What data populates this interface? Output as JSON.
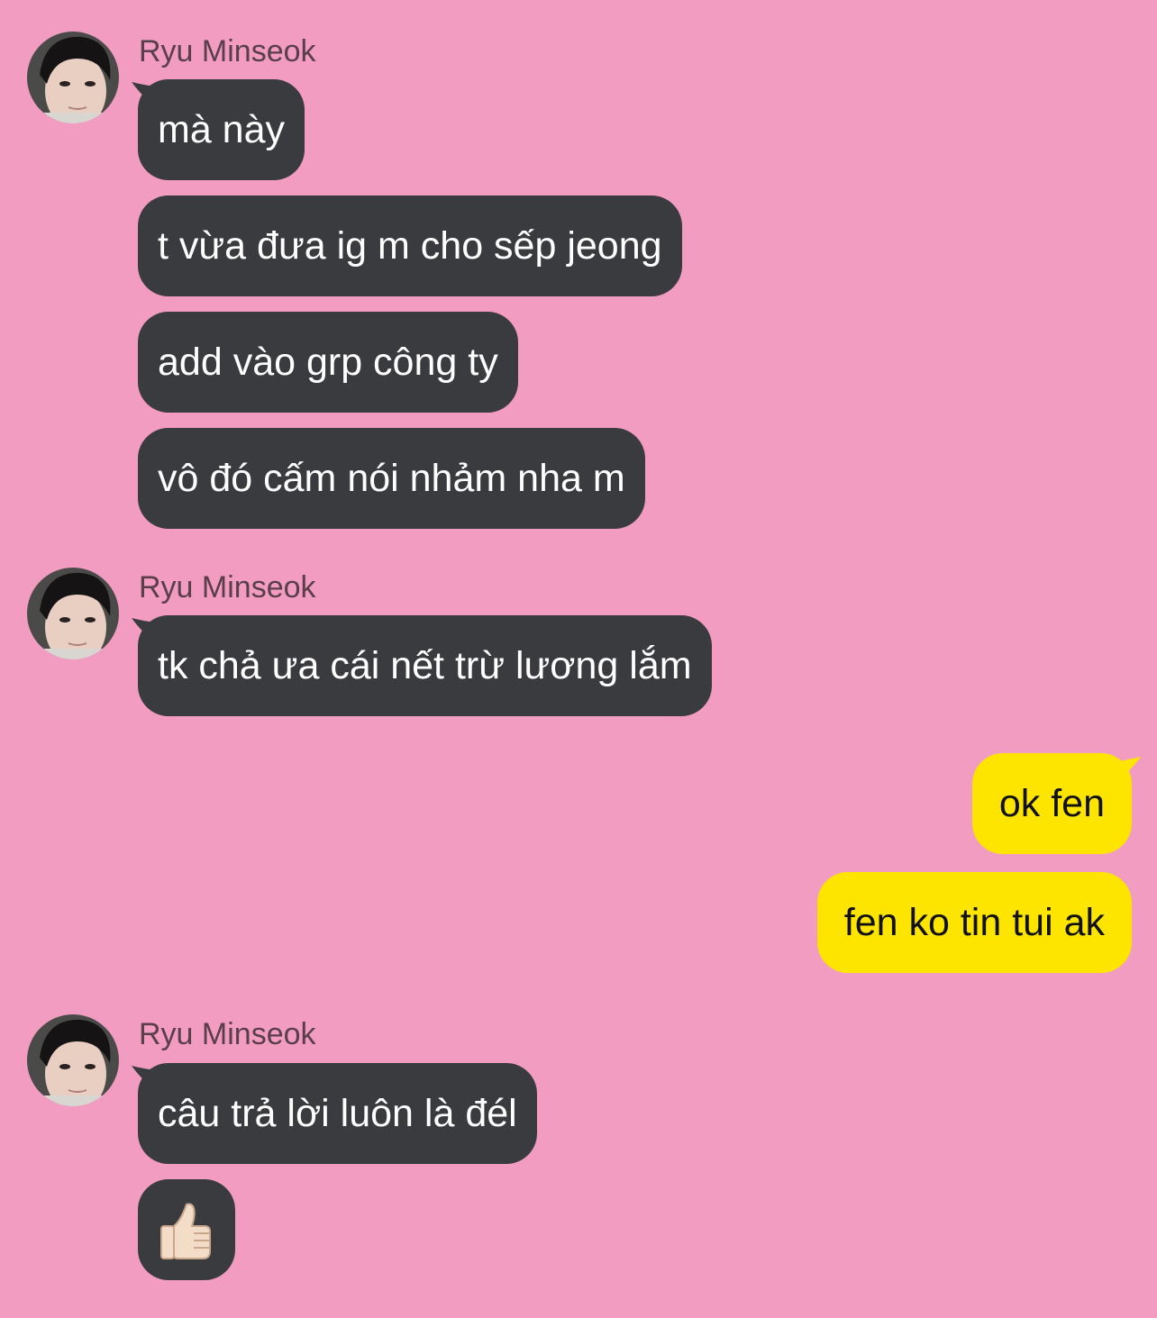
{
  "chat": {
    "groups": [
      {
        "sender": "Ryu Minseok",
        "messages": [
          "mà này",
          "t vừa đưa ig m cho sếp jeong",
          "add vào grp công ty",
          "vô đó cấm nói nhảm nha m"
        ]
      },
      {
        "sender": "Ryu Minseok",
        "messages": [
          "tk chả ưa cái nết trừ lương lắm"
        ]
      },
      {
        "sender": "Ryu Minseok",
        "messages": [
          "câu trả lời luôn là đél"
        ],
        "sticker": "thumbs-up-emoji"
      }
    ],
    "outgoing": [
      "ok fen",
      "fen ko tin tui ak"
    ]
  },
  "colors": {
    "background": "#f29cc2",
    "incoming_bubble": "#3a3b3e",
    "outgoing_bubble": "#fde500",
    "sender_name": "#5a3f4a"
  }
}
